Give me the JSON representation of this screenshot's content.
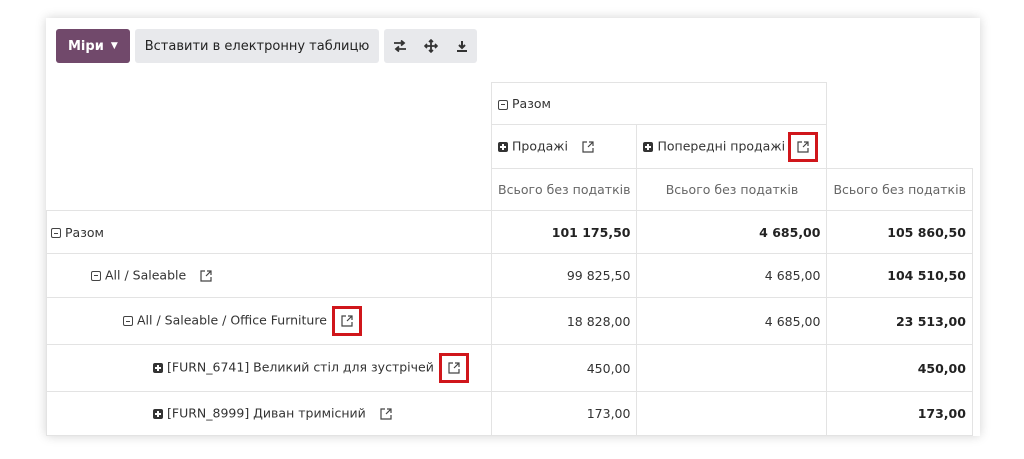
{
  "toolbar": {
    "measures_label": "Міри",
    "insert_spreadsheet_label": "Вставити в електронну таблицю",
    "icons": [
      "flip-axis-icon",
      "expand-all-icon",
      "download-icon"
    ]
  },
  "columns": {
    "total_label": "Разом",
    "groups": [
      {
        "label": "Продажі"
      },
      {
        "label": "Попередні продажі"
      }
    ],
    "measure_label": "Всього без податків"
  },
  "rows": [
    {
      "label": "Разом",
      "v1": "101 175,50",
      "v2": "4 685,00",
      "total": "105 860,50"
    },
    {
      "label": "All / Saleable",
      "v1": "99 825,50",
      "v2": "4 685,00",
      "total": "104 510,50"
    },
    {
      "label": "All / Saleable / Office Furniture",
      "v1": "18 828,00",
      "v2": "4 685,00",
      "total": "23 513,00"
    },
    {
      "label": "[FURN_6741] Великий стіл для зустрічей",
      "v1": "450,00",
      "v2": "",
      "total": "450,00"
    },
    {
      "label": "[FURN_8999] Диван тримісний",
      "v1": "173,00",
      "v2": "",
      "total": "173,00"
    }
  ],
  "colors": {
    "primary": "#71496b",
    "highlight": "#d0161b"
  }
}
